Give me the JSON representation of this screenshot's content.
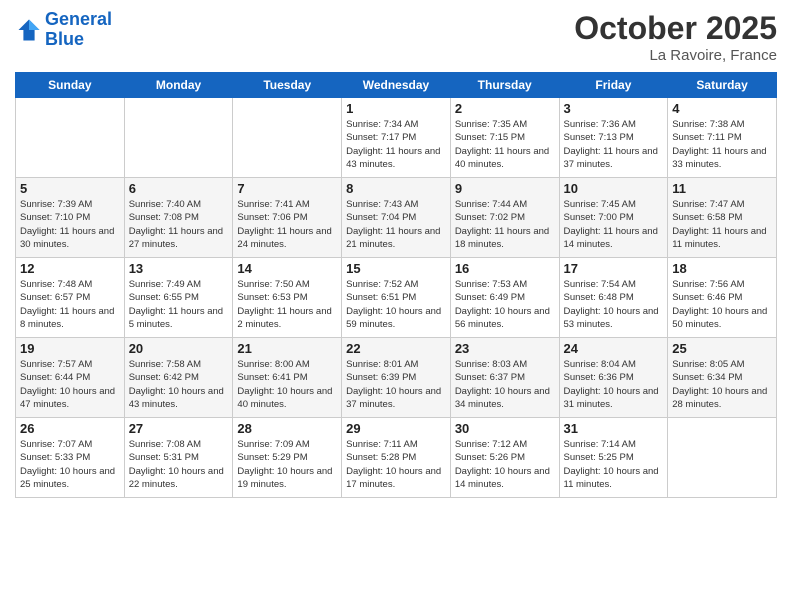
{
  "header": {
    "logo_line1": "General",
    "logo_line2": "Blue",
    "month": "October 2025",
    "location": "La Ravoire, France"
  },
  "weekdays": [
    "Sunday",
    "Monday",
    "Tuesday",
    "Wednesday",
    "Thursday",
    "Friday",
    "Saturday"
  ],
  "weeks": [
    [
      {
        "date": "",
        "info": ""
      },
      {
        "date": "",
        "info": ""
      },
      {
        "date": "",
        "info": ""
      },
      {
        "date": "1",
        "info": "Sunrise: 7:34 AM\nSunset: 7:17 PM\nDaylight: 11 hours and 43 minutes."
      },
      {
        "date": "2",
        "info": "Sunrise: 7:35 AM\nSunset: 7:15 PM\nDaylight: 11 hours and 40 minutes."
      },
      {
        "date": "3",
        "info": "Sunrise: 7:36 AM\nSunset: 7:13 PM\nDaylight: 11 hours and 37 minutes."
      },
      {
        "date": "4",
        "info": "Sunrise: 7:38 AM\nSunset: 7:11 PM\nDaylight: 11 hours and 33 minutes."
      }
    ],
    [
      {
        "date": "5",
        "info": "Sunrise: 7:39 AM\nSunset: 7:10 PM\nDaylight: 11 hours and 30 minutes."
      },
      {
        "date": "6",
        "info": "Sunrise: 7:40 AM\nSunset: 7:08 PM\nDaylight: 11 hours and 27 minutes."
      },
      {
        "date": "7",
        "info": "Sunrise: 7:41 AM\nSunset: 7:06 PM\nDaylight: 11 hours and 24 minutes."
      },
      {
        "date": "8",
        "info": "Sunrise: 7:43 AM\nSunset: 7:04 PM\nDaylight: 11 hours and 21 minutes."
      },
      {
        "date": "9",
        "info": "Sunrise: 7:44 AM\nSunset: 7:02 PM\nDaylight: 11 hours and 18 minutes."
      },
      {
        "date": "10",
        "info": "Sunrise: 7:45 AM\nSunset: 7:00 PM\nDaylight: 11 hours and 14 minutes."
      },
      {
        "date": "11",
        "info": "Sunrise: 7:47 AM\nSunset: 6:58 PM\nDaylight: 11 hours and 11 minutes."
      }
    ],
    [
      {
        "date": "12",
        "info": "Sunrise: 7:48 AM\nSunset: 6:57 PM\nDaylight: 11 hours and 8 minutes."
      },
      {
        "date": "13",
        "info": "Sunrise: 7:49 AM\nSunset: 6:55 PM\nDaylight: 11 hours and 5 minutes."
      },
      {
        "date": "14",
        "info": "Sunrise: 7:50 AM\nSunset: 6:53 PM\nDaylight: 11 hours and 2 minutes."
      },
      {
        "date": "15",
        "info": "Sunrise: 7:52 AM\nSunset: 6:51 PM\nDaylight: 10 hours and 59 minutes."
      },
      {
        "date": "16",
        "info": "Sunrise: 7:53 AM\nSunset: 6:49 PM\nDaylight: 10 hours and 56 minutes."
      },
      {
        "date": "17",
        "info": "Sunrise: 7:54 AM\nSunset: 6:48 PM\nDaylight: 10 hours and 53 minutes."
      },
      {
        "date": "18",
        "info": "Sunrise: 7:56 AM\nSunset: 6:46 PM\nDaylight: 10 hours and 50 minutes."
      }
    ],
    [
      {
        "date": "19",
        "info": "Sunrise: 7:57 AM\nSunset: 6:44 PM\nDaylight: 10 hours and 47 minutes."
      },
      {
        "date": "20",
        "info": "Sunrise: 7:58 AM\nSunset: 6:42 PM\nDaylight: 10 hours and 43 minutes."
      },
      {
        "date": "21",
        "info": "Sunrise: 8:00 AM\nSunset: 6:41 PM\nDaylight: 10 hours and 40 minutes."
      },
      {
        "date": "22",
        "info": "Sunrise: 8:01 AM\nSunset: 6:39 PM\nDaylight: 10 hours and 37 minutes."
      },
      {
        "date": "23",
        "info": "Sunrise: 8:03 AM\nSunset: 6:37 PM\nDaylight: 10 hours and 34 minutes."
      },
      {
        "date": "24",
        "info": "Sunrise: 8:04 AM\nSunset: 6:36 PM\nDaylight: 10 hours and 31 minutes."
      },
      {
        "date": "25",
        "info": "Sunrise: 8:05 AM\nSunset: 6:34 PM\nDaylight: 10 hours and 28 minutes."
      }
    ],
    [
      {
        "date": "26",
        "info": "Sunrise: 7:07 AM\nSunset: 5:33 PM\nDaylight: 10 hours and 25 minutes."
      },
      {
        "date": "27",
        "info": "Sunrise: 7:08 AM\nSunset: 5:31 PM\nDaylight: 10 hours and 22 minutes."
      },
      {
        "date": "28",
        "info": "Sunrise: 7:09 AM\nSunset: 5:29 PM\nDaylight: 10 hours and 19 minutes."
      },
      {
        "date": "29",
        "info": "Sunrise: 7:11 AM\nSunset: 5:28 PM\nDaylight: 10 hours and 17 minutes."
      },
      {
        "date": "30",
        "info": "Sunrise: 7:12 AM\nSunset: 5:26 PM\nDaylight: 10 hours and 14 minutes."
      },
      {
        "date": "31",
        "info": "Sunrise: 7:14 AM\nSunset: 5:25 PM\nDaylight: 10 hours and 11 minutes."
      },
      {
        "date": "",
        "info": ""
      }
    ]
  ]
}
